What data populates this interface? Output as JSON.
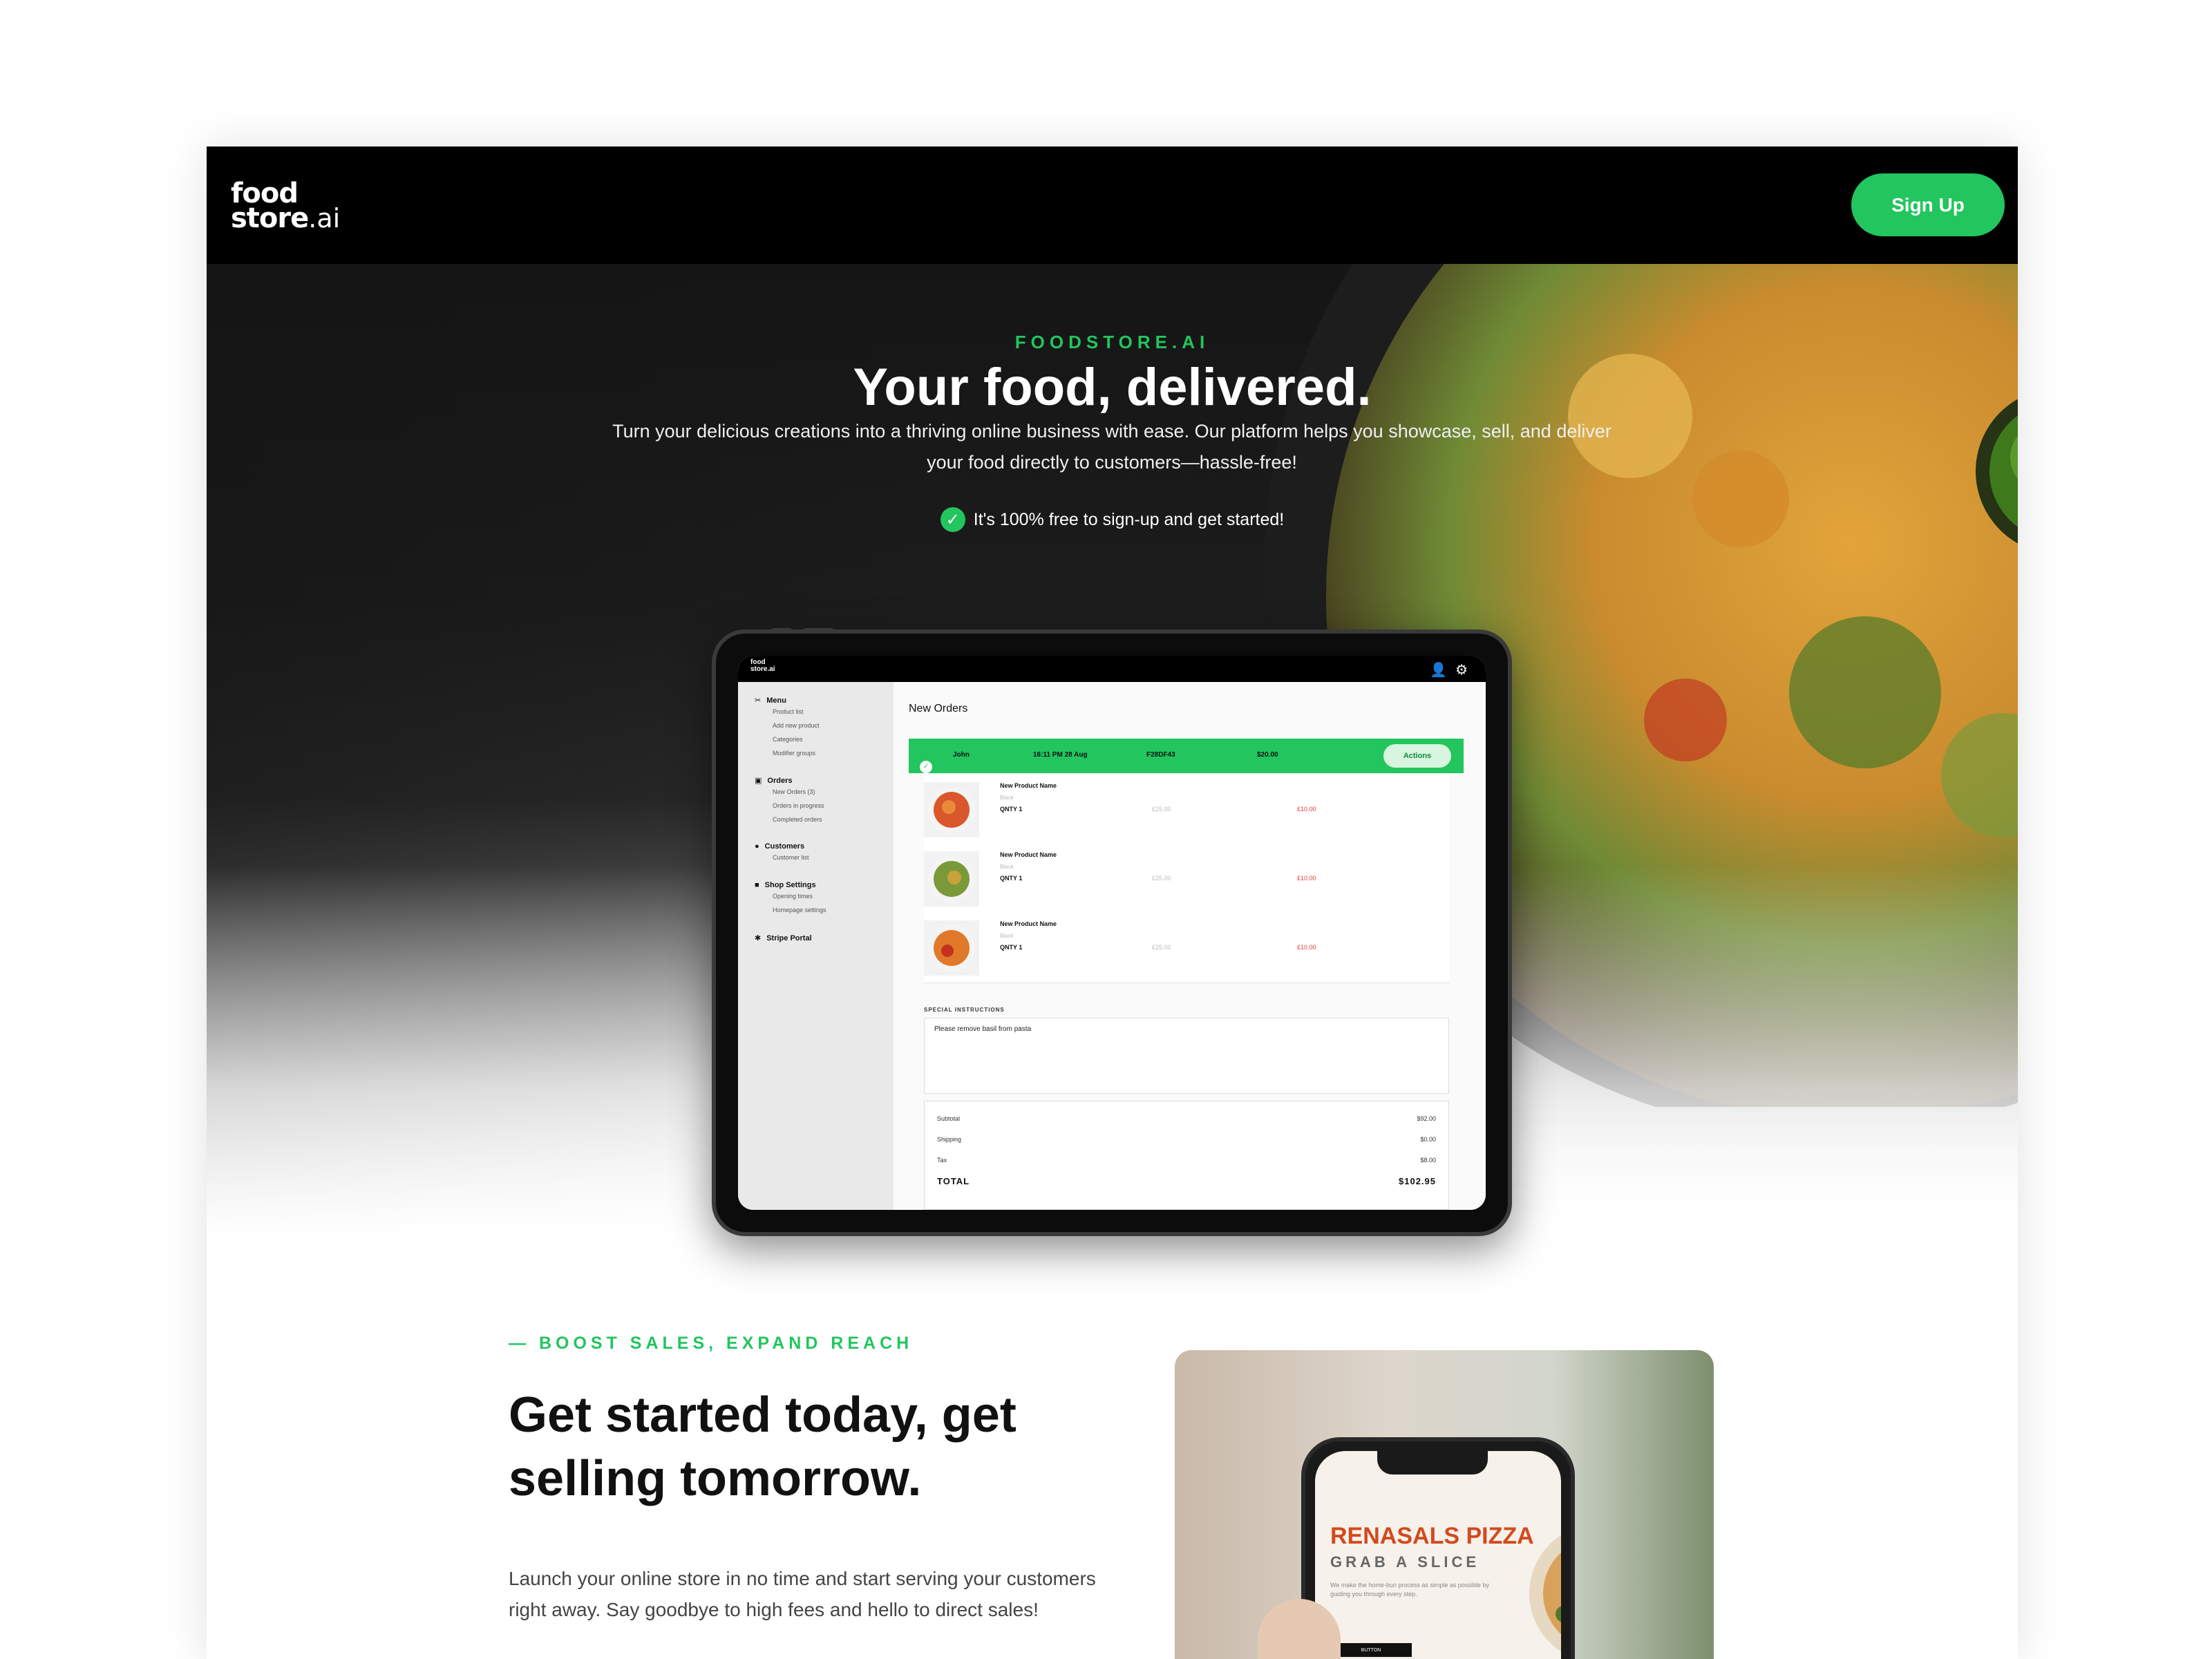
{
  "brand": {
    "logo_line1": "food",
    "logo_line2": "store",
    "logo_suffix": ".ai",
    "accent": "#22c55e"
  },
  "nav": {
    "signup_label": "Sign Up"
  },
  "hero": {
    "eyebrow": "FOODSTORE.AI",
    "title": "Your food, delivered.",
    "subtitle": "Turn your delicious creations into a thriving online business with ease. Our platform helps you showcase, sell, and deliver your food directly to customers—hassle-free!",
    "free_note": "It's 100% free to sign-up and get started!"
  },
  "dashboard": {
    "logo_line1": "food",
    "logo_line2": "store.ai",
    "icons": [
      "user-icon",
      "gear-icon"
    ],
    "sidebar": [
      {
        "label": "Menu",
        "icon": "utensils-icon",
        "items": [
          "Product list",
          "Add new product",
          "Categories",
          "Modifier groups"
        ]
      },
      {
        "label": "Orders",
        "icon": "inbox-icon",
        "items": [
          "New Orders (3)",
          "Orders in progress",
          "Completed orders"
        ]
      },
      {
        "label": "Customers",
        "icon": "users-icon",
        "items": [
          "Customer list"
        ]
      },
      {
        "label": "Shop Settings",
        "icon": "store-icon",
        "items": [
          "Opening times",
          "Homepage settings"
        ]
      },
      {
        "label": "Stripe Portal",
        "icon": "cog-icon",
        "items": []
      }
    ],
    "title": "New Orders",
    "order": {
      "name": "John",
      "time": "16:11 PM 28 Aug",
      "id": "F28DF43",
      "amount": "$20.00",
      "actions": "Actions"
    },
    "items": [
      {
        "name": "New Product Name",
        "variant": "Black",
        "qty": "QNTY 1",
        "price": "£25.00",
        "total": "£10.00"
      },
      {
        "name": "New Product Name",
        "variant": "Black",
        "qty": "QNTY 1",
        "price": "£25.00",
        "total": "£10.00"
      },
      {
        "name": "New Product Name",
        "variant": "Black",
        "qty": "QNTY 1",
        "price": "£25.00",
        "total": "£10.00"
      }
    ],
    "special_label": "SPECIAL INSTRUCTIONS",
    "special_text": "Please remove basil from pasta",
    "totals": [
      {
        "label": "Subtotal",
        "value": "$92.00"
      },
      {
        "label": "Shipping",
        "value": "$0.00"
      },
      {
        "label": "Tax",
        "value": "$8.00"
      }
    ],
    "total_label": "TOTAL",
    "total_value": "$102.95"
  },
  "section2": {
    "eyebrow": "— BOOST SALES, EXPAND REACH",
    "title": "Get started today, get selling tomorrow.",
    "text": "Launch your online store in no time and start serving your customers right away. Say goodbye to high fees and hello to direct sales!",
    "phone": {
      "title": "RENASALS PIZZA",
      "subtitle": "GRAB A SLICE",
      "body": "We make the home-bun process as simple as possible by guiding you through every step.",
      "button": "BUTTON"
    }
  }
}
